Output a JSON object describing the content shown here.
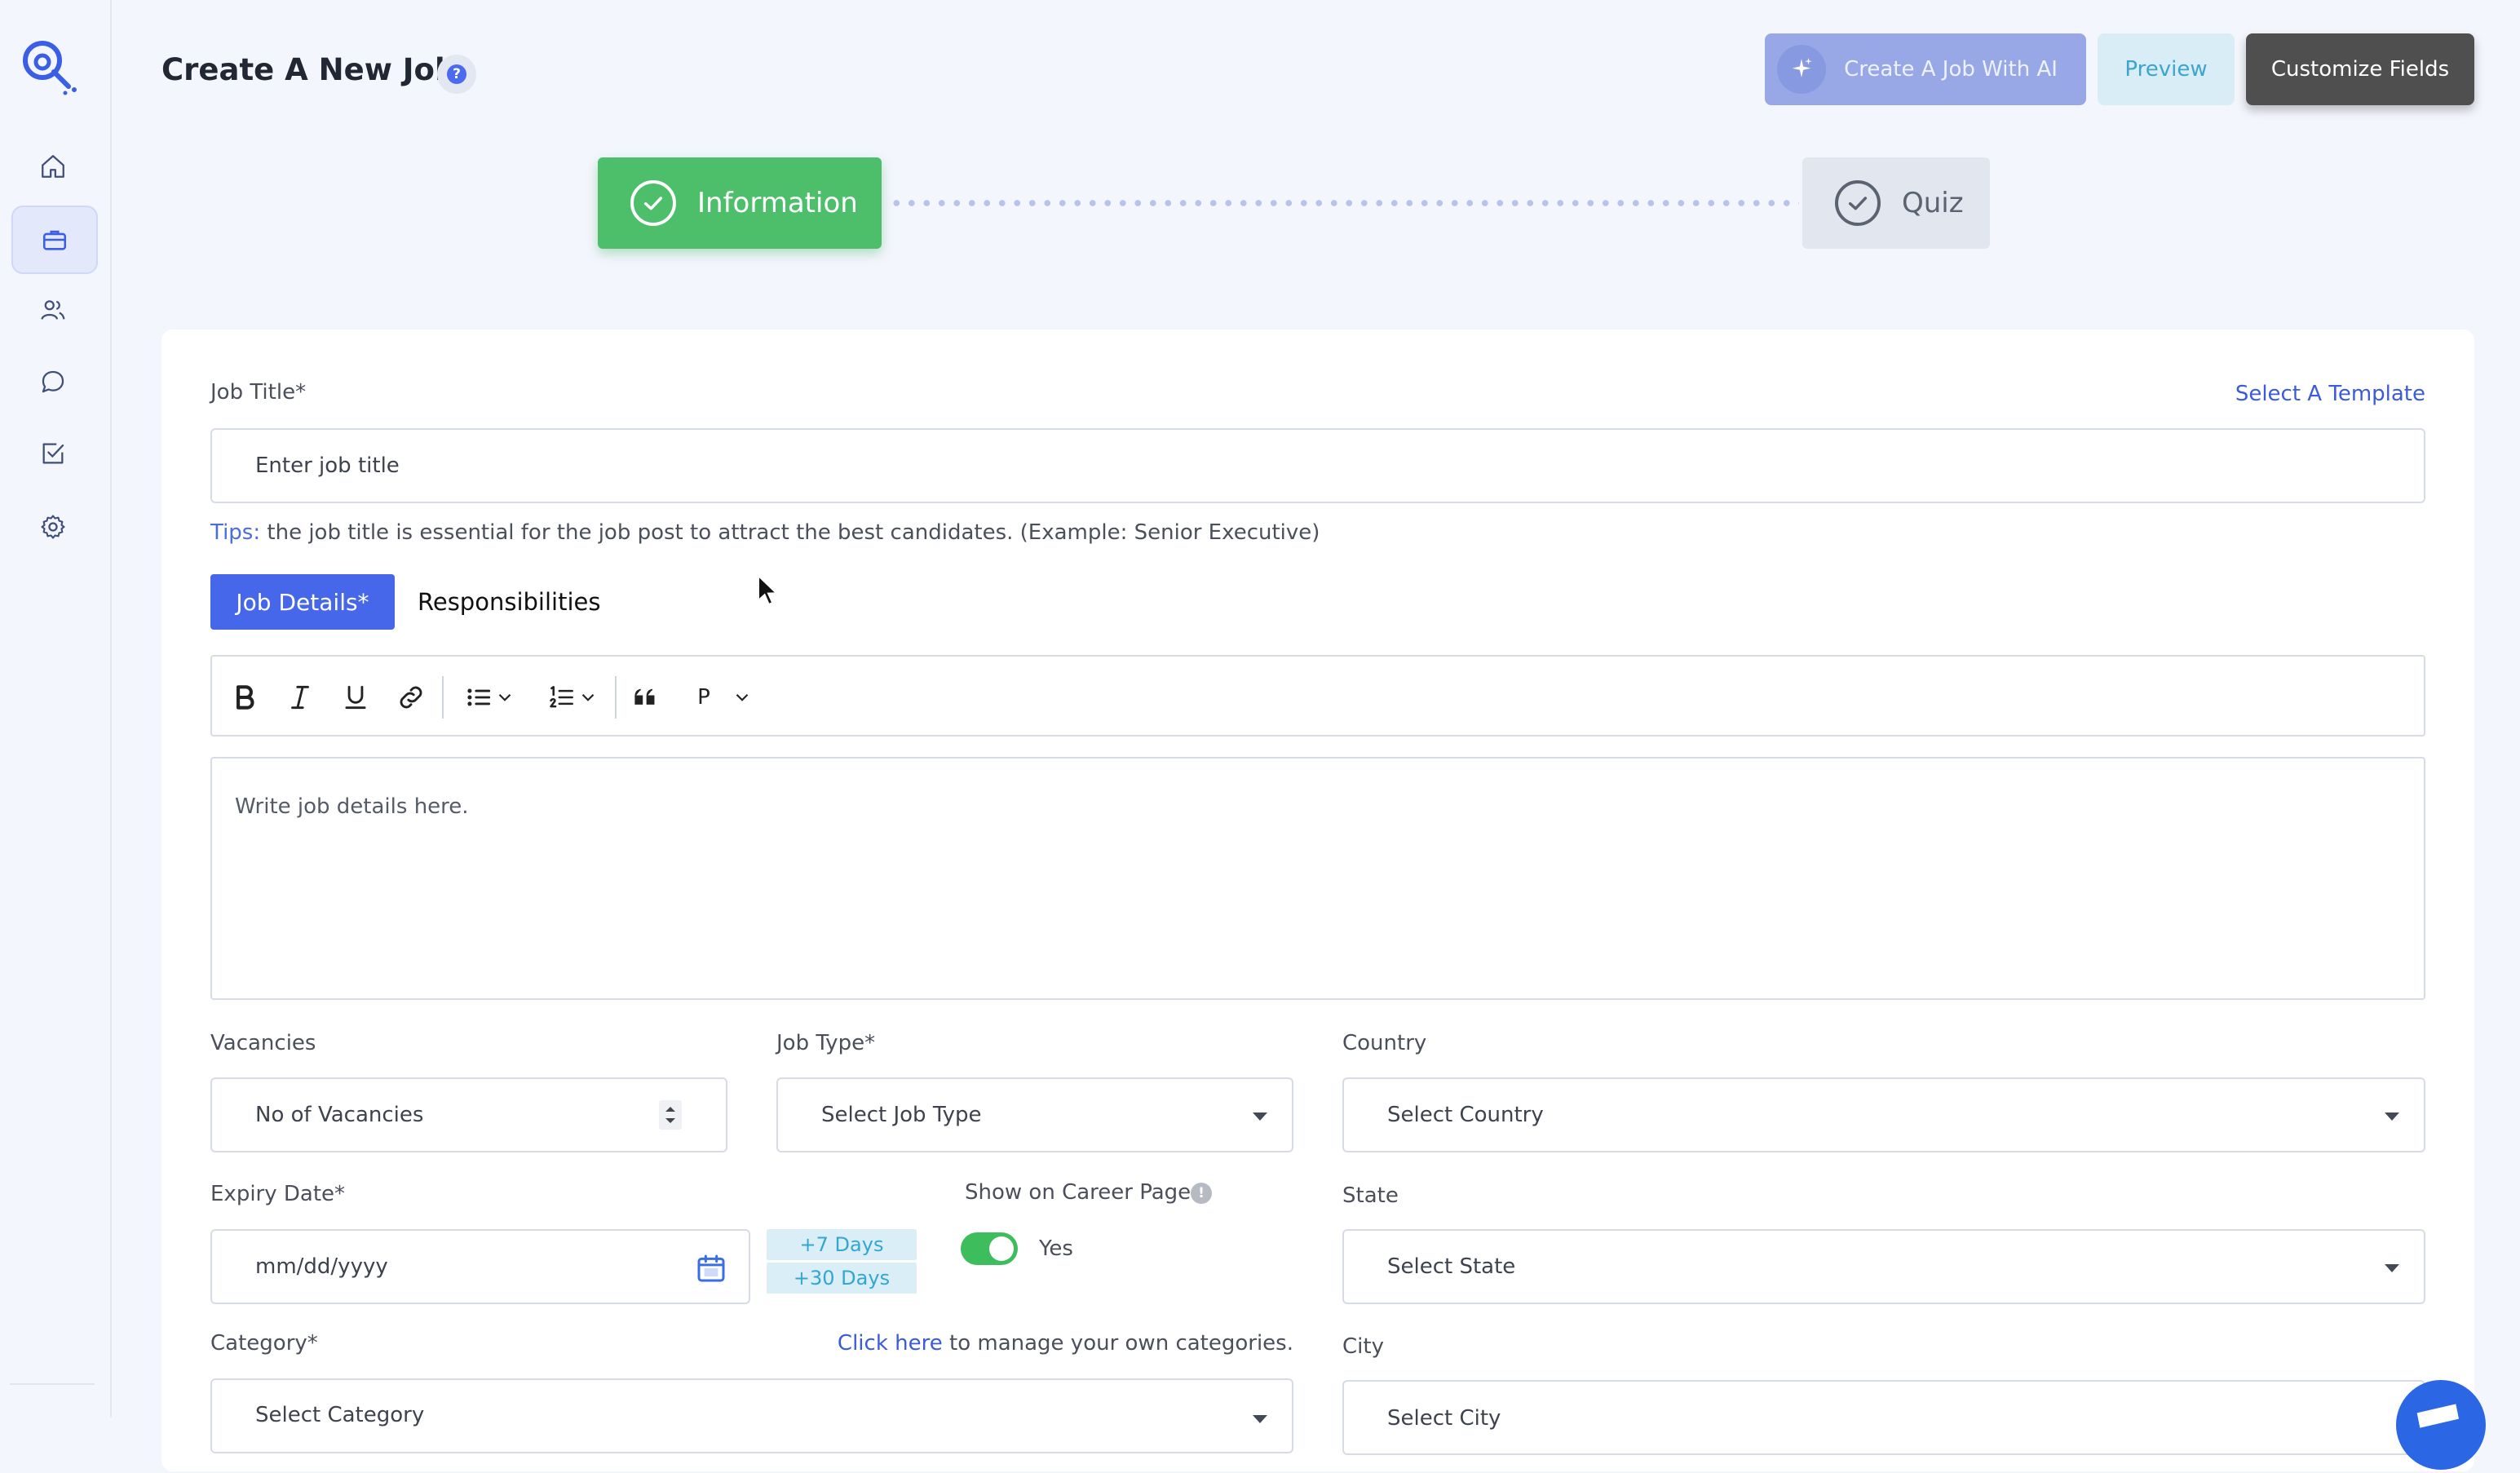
{
  "header": {
    "title": "Create A New Job",
    "help_icon": "?",
    "ai_button_label": "Create A Job With AI",
    "preview_label": "Preview",
    "customize_label": "Customize Fields"
  },
  "sidebar": {
    "items": [
      {
        "name": "home",
        "icon": "home-icon"
      },
      {
        "name": "jobs",
        "icon": "briefcase-icon",
        "active": true
      },
      {
        "name": "candidates",
        "icon": "users-icon"
      },
      {
        "name": "messages",
        "icon": "chat-icon"
      },
      {
        "name": "tasks",
        "icon": "checkbox-icon"
      },
      {
        "name": "settings",
        "icon": "gear-icon"
      }
    ]
  },
  "stepper": {
    "steps": [
      {
        "label": "Information",
        "state": "complete"
      },
      {
        "label": "Quiz",
        "state": "pending"
      }
    ]
  },
  "form": {
    "job_title_label": "Job Title*",
    "select_template_label": "Select A Template",
    "job_title_placeholder": "Enter  job title",
    "tips_prefix": "Tips:",
    "tips_text": " the job title is essential for the job post to attract the best candidates. (Example: Senior Executive)",
    "tabs": [
      "Job Details*",
      "Responsibilities"
    ],
    "toolbar_paragraph_label": "P",
    "editor_placeholder": "Write job details here.",
    "vacancies_label": "Vacancies",
    "vacancies_placeholder": "No of Vacancies",
    "job_type_label": "Job Type*",
    "job_type_value": "Select Job Type",
    "country_label": "Country",
    "country_value": "Select Country",
    "expiry_label": "Expiry Date*",
    "expiry_placeholder": "mm/dd/yyyy",
    "quick_add": [
      "+7 Days",
      "+30 Days"
    ],
    "career_page_label": "Show on Career Page",
    "career_page_toggle": true,
    "career_page_value": "Yes",
    "state_label": "State",
    "state_value": "Select State",
    "category_label": "Category*",
    "category_link": "Click here",
    "category_help": " to manage your own categories.",
    "category_value": "Select Category",
    "city_label": "City",
    "city_value": "Select City"
  },
  "colors": {
    "accent": "#4667ea",
    "success": "#4dbf6b",
    "link": "#3b5bdb",
    "tip": "#35a6cf"
  }
}
